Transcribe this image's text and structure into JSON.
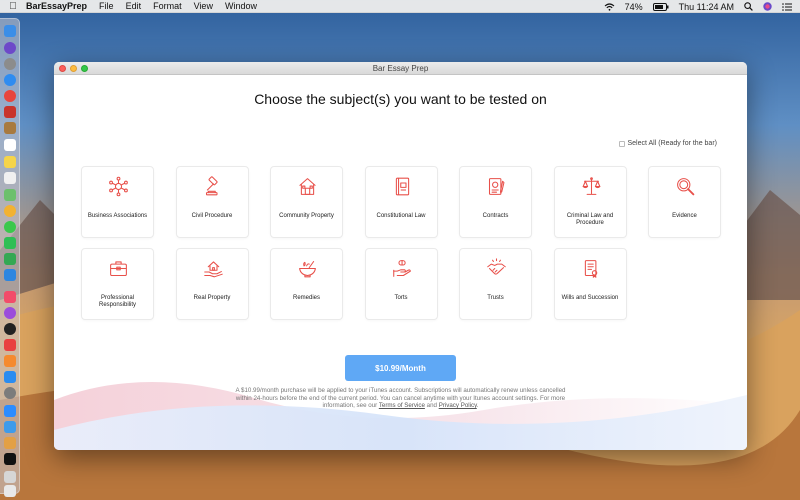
{
  "menubar": {
    "app_name": "BarEssayPrep",
    "menus": [
      "File",
      "Edit",
      "Format",
      "View",
      "Window"
    ],
    "battery": "74%",
    "clock": "Thu 11:24 AM"
  },
  "window": {
    "title": "Bar Essay Prep"
  },
  "main": {
    "heading": "Choose the subject(s) you want to be tested on",
    "select_all_label": "Select All (Ready for the bar)",
    "subjects": [
      {
        "label": "Business Associations",
        "icon": "network-icon"
      },
      {
        "label": "Civil Procedure",
        "icon": "gavel-icon"
      },
      {
        "label": "Community Property",
        "icon": "house-icon"
      },
      {
        "label": "Constitutional Law",
        "icon": "book-icon"
      },
      {
        "label": "Contracts",
        "icon": "contract-icon"
      },
      {
        "label": "Criminal Law and Procedure",
        "icon": "scales-icon"
      },
      {
        "label": "Evidence",
        "icon": "magnifier-icon"
      },
      {
        "label": "Professional Responsibility",
        "icon": "briefcase-icon"
      },
      {
        "label": "Real Property",
        "icon": "property-hand-icon"
      },
      {
        "label": "Remedies",
        "icon": "mortar-icon"
      },
      {
        "label": "Torts",
        "icon": "hand-pill-icon"
      },
      {
        "label": "Trusts",
        "icon": "handshake-icon"
      },
      {
        "label": "Wills and Succession",
        "icon": "will-document-icon"
      }
    ],
    "price_button": "$10.99/Month",
    "disclaimer_text": "A $10.99/month purchase will be applied to your iTunes account. Subscriptions will automatically renew unless cancelled within 24-hours before the end of the current period. You can cancel anytime with your Itunes account settings. For more information, see our",
    "terms_link": "Terms of Service",
    "and_text": "and",
    "privacy_link": "Privacy Policy",
    "period": "."
  },
  "colors": {
    "accent": "#5fa8f5",
    "icon_red": "#e8504a"
  }
}
